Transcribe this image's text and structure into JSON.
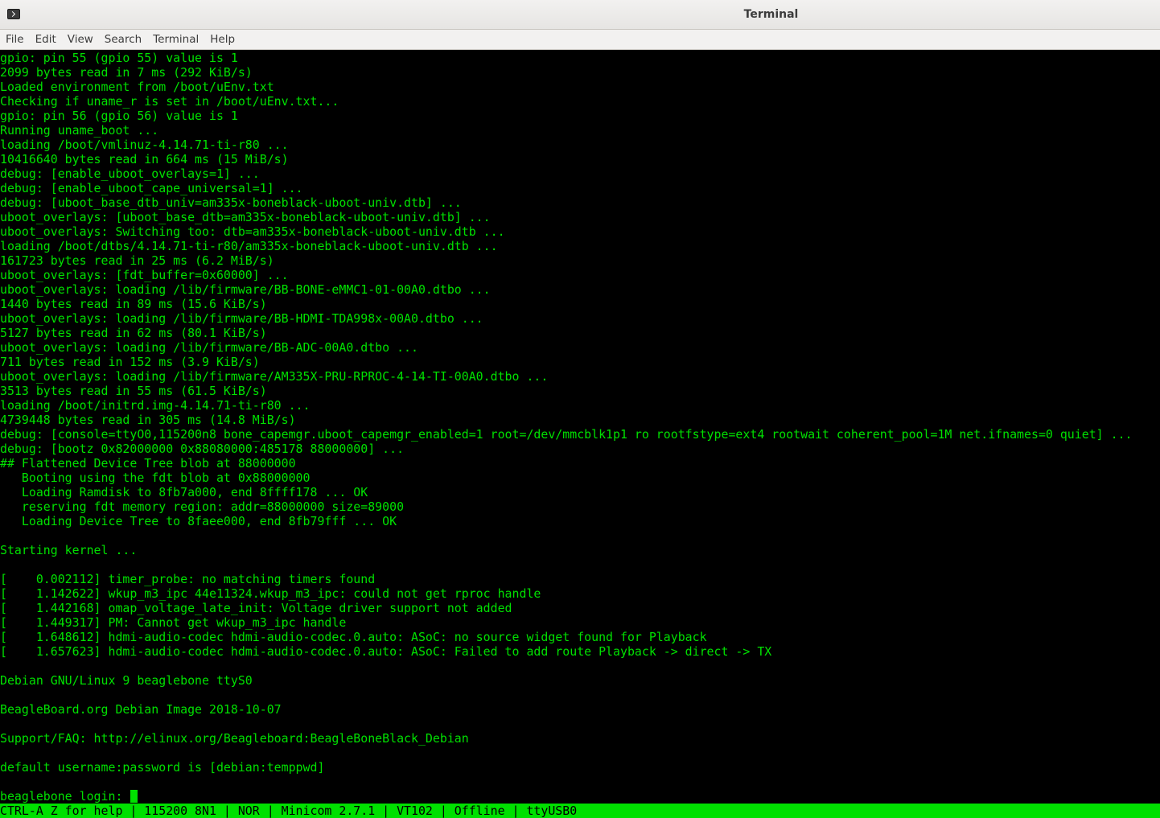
{
  "window": {
    "title": "Terminal",
    "icon": "terminal-icon"
  },
  "menubar": {
    "items": [
      "File",
      "Edit",
      "View",
      "Search",
      "Terminal",
      "Help"
    ]
  },
  "terminal": {
    "colors": {
      "foreground": "#00e000",
      "background": "#000000"
    },
    "lines": [
      "gpio: pin 55 (gpio 55) value is 1",
      "2099 bytes read in 7 ms (292 KiB/s)",
      "Loaded environment from /boot/uEnv.txt",
      "Checking if uname_r is set in /boot/uEnv.txt...",
      "gpio: pin 56 (gpio 56) value is 1",
      "Running uname_boot ...",
      "loading /boot/vmlinuz-4.14.71-ti-r80 ...",
      "10416640 bytes read in 664 ms (15 MiB/s)",
      "debug: [enable_uboot_overlays=1] ...",
      "debug: [enable_uboot_cape_universal=1] ...",
      "debug: [uboot_base_dtb_univ=am335x-boneblack-uboot-univ.dtb] ...",
      "uboot_overlays: [uboot_base_dtb=am335x-boneblack-uboot-univ.dtb] ...",
      "uboot_overlays: Switching too: dtb=am335x-boneblack-uboot-univ.dtb ...",
      "loading /boot/dtbs/4.14.71-ti-r80/am335x-boneblack-uboot-univ.dtb ...",
      "161723 bytes read in 25 ms (6.2 MiB/s)",
      "uboot_overlays: [fdt_buffer=0x60000] ...",
      "uboot_overlays: loading /lib/firmware/BB-BONE-eMMC1-01-00A0.dtbo ...",
      "1440 bytes read in 89 ms (15.6 KiB/s)",
      "uboot_overlays: loading /lib/firmware/BB-HDMI-TDA998x-00A0.dtbo ...",
      "5127 bytes read in 62 ms (80.1 KiB/s)",
      "uboot_overlays: loading /lib/firmware/BB-ADC-00A0.dtbo ...",
      "711 bytes read in 152 ms (3.9 KiB/s)",
      "uboot_overlays: loading /lib/firmware/AM335X-PRU-RPROC-4-14-TI-00A0.dtbo ...",
      "3513 bytes read in 55 ms (61.5 KiB/s)",
      "loading /boot/initrd.img-4.14.71-ti-r80 ...",
      "4739448 bytes read in 305 ms (14.8 MiB/s)",
      "debug: [console=ttyO0,115200n8 bone_capemgr.uboot_capemgr_enabled=1 root=/dev/mmcblk1p1 ro rootfstype=ext4 rootwait coherent_pool=1M net.ifnames=0 quiet] ...",
      "debug: [bootz 0x82000000 0x88080000:485178 88000000] ...",
      "## Flattened Device Tree blob at 88000000",
      "   Booting using the fdt blob at 0x88000000",
      "   Loading Ramdisk to 8fb7a000, end 8ffff178 ... OK",
      "   reserving fdt memory region: addr=88000000 size=89000",
      "   Loading Device Tree to 8faee000, end 8fb79fff ... OK",
      "",
      "Starting kernel ...",
      "",
      "[    0.002112] timer_probe: no matching timers found",
      "[    1.142622] wkup_m3_ipc 44e11324.wkup_m3_ipc: could not get rproc handle",
      "[    1.442168] omap_voltage_late_init: Voltage driver support not added",
      "[    1.449317] PM: Cannot get wkup_m3_ipc handle",
      "[    1.648612] hdmi-audio-codec hdmi-audio-codec.0.auto: ASoC: no source widget found for Playback",
      "[    1.657623] hdmi-audio-codec hdmi-audio-codec.0.auto: ASoC: Failed to add route Playback -> direct -> TX",
      "",
      "Debian GNU/Linux 9 beaglebone ttyS0",
      "",
      "BeagleBoard.org Debian Image 2018-10-07",
      "",
      "Support/FAQ: http://elinux.org/Beagleboard:BeagleBoneBlack_Debian",
      "",
      "default username:password is [debian:temppwd]",
      ""
    ],
    "prompt": "beaglebone login: "
  },
  "statusbar": {
    "text": "CTRL-A Z for help | 115200 8N1 | NOR | Minicom 2.7.1 | VT102 | Offline | ttyUSB0"
  }
}
